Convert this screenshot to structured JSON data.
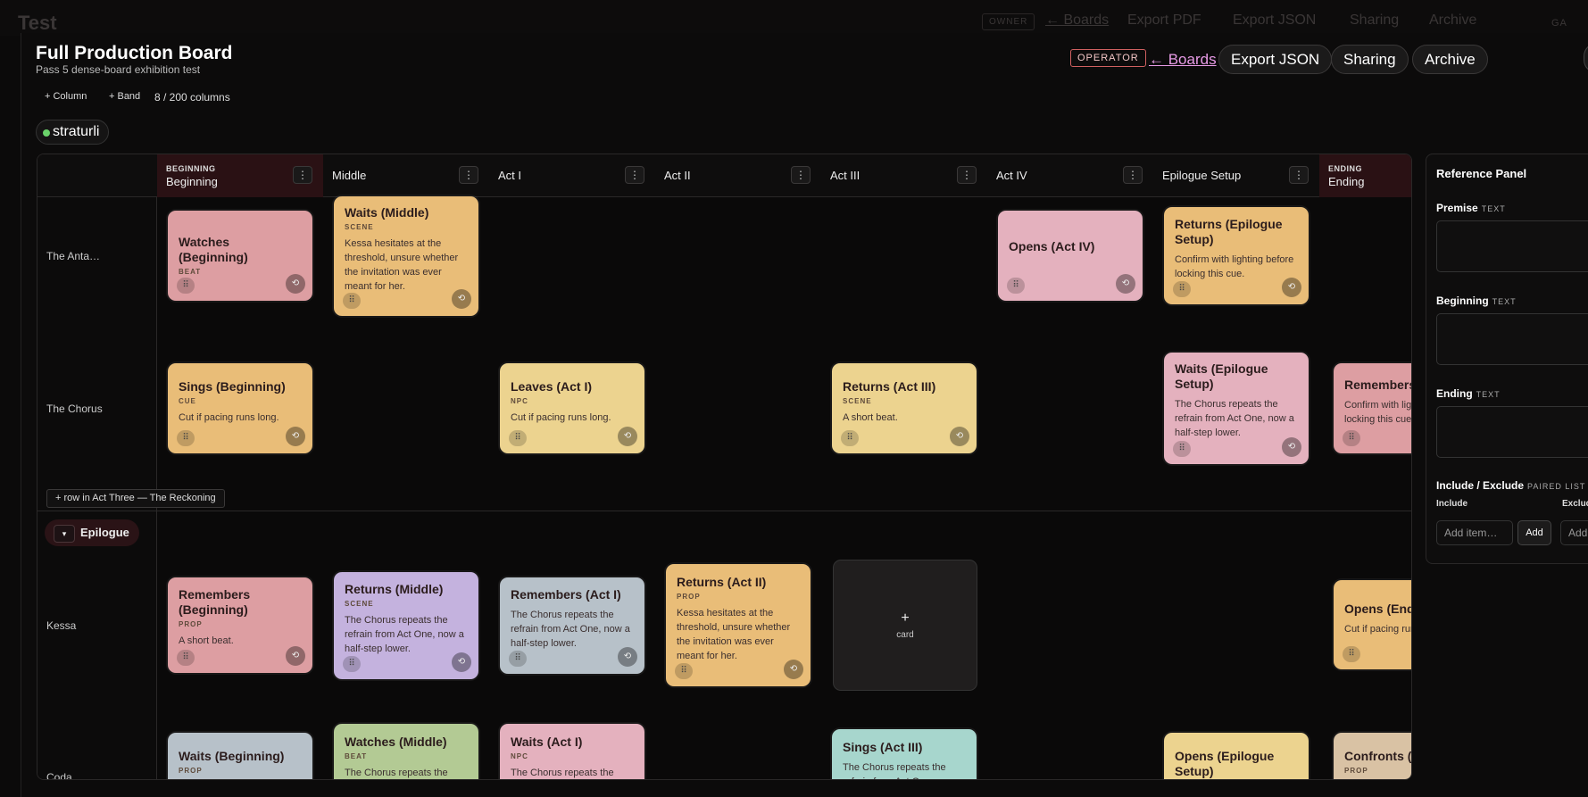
{
  "background_app": {
    "title": "Test",
    "owner_badge": "OWNER",
    "boards_link": "← Boards",
    "export_pdf": "Export PDF",
    "export_json": "Export JSON",
    "sharing": "Sharing",
    "archive": "Archive",
    "avatar": "GA"
  },
  "header": {
    "title": "Full Production Board",
    "subtitle": "Pass 5 dense-board exhibition test",
    "role_badge": "OPERATOR",
    "boards_link": "← Boards",
    "export_json": "Export JSON",
    "sharing": "Sharing",
    "archive": "Archive"
  },
  "toolbar": {
    "add_column": "+ Column",
    "add_band": "+ Band",
    "column_count": "8 / 200 columns"
  },
  "presence": {
    "user": "straturli",
    "status_color": "#6ad26a"
  },
  "columns": [
    {
      "kicker": "BEGINNING",
      "name": "Beginning",
      "menu": "⋮"
    },
    {
      "name": "Middle",
      "menu": "⋮"
    },
    {
      "name": "Act I",
      "menu": "⋮"
    },
    {
      "name": "Act II",
      "menu": "⋮"
    },
    {
      "name": "Act III",
      "menu": "⋮"
    },
    {
      "name": "Act IV",
      "menu": "⋮"
    },
    {
      "name": "Epilogue Setup",
      "menu": "⋮"
    },
    {
      "kicker": "ENDING",
      "name": "Ending"
    }
  ],
  "rows": [
    "The Anta…",
    "The Chorus",
    "Kessa",
    "Coda"
  ],
  "add_row_label": "+ row in Act Three — The Reckoning",
  "band": {
    "toggle": "▾",
    "name": "Epilogue"
  },
  "card_controls": {
    "drag": "⠿",
    "cycle": "⟲"
  },
  "cards": {
    "c1": {
      "title": "Watches (Beginning)",
      "type": "BEAT"
    },
    "c2": {
      "title": "Waits (Middle)",
      "type": "SCENE",
      "body": "Kessa hesitates at the threshold, unsure whether the invitation was ever meant for her."
    },
    "c3": {
      "title": "Opens (Act IV)"
    },
    "c4": {
      "title": "Returns (Epilogue Setup)",
      "body": "Confirm with lighting before locking this cue."
    },
    "c5": {
      "title": "Sings (Beginning)",
      "type": "CUE",
      "body": "Cut if pacing runs long."
    },
    "c6": {
      "title": "Leaves (Act I)",
      "type": "NPC",
      "body": "Cut if pacing runs long."
    },
    "c7": {
      "title": "Returns (Act III)",
      "type": "SCENE",
      "body": "A short beat."
    },
    "c8": {
      "title": "Waits (Epilogue Setup)",
      "body": "The Chorus repeats the refrain from Act One, now a half-step lower."
    },
    "c9": {
      "title": "Remembers (Ending)",
      "body": "Confirm with lighting before locking this cue."
    },
    "c10": {
      "title": "Remembers (Beginning)",
      "type": "PROP",
      "body": "A short beat."
    },
    "c11": {
      "title": "Returns (Middle)",
      "type": "SCENE",
      "body": "The Chorus repeats the refrain from Act One, now a half-step lower."
    },
    "c12": {
      "title": "Remembers (Act I)",
      "body": "The Chorus repeats the refrain from Act One, now a half-step lower."
    },
    "c13": {
      "title": "Returns (Act II)",
      "type": "PROP",
      "body": "Kessa hesitates at the threshold, unsure whether the invitation was ever meant for her."
    },
    "c14": {
      "title": "Opens (Ending)",
      "body": "Cut if pacing runs long."
    },
    "c15": {
      "title": "Waits (Beginning)",
      "type": "PROP"
    },
    "c16": {
      "title": "Watches (Middle)",
      "type": "BEAT",
      "body": "The Chorus repeats the"
    },
    "c17": {
      "title": "Waits (Act I)",
      "type": "NPC",
      "body": "The Chorus repeats the"
    },
    "c18": {
      "title": "Sings (Act III)",
      "body": "The Chorus repeats the refrain from Act One, now"
    },
    "c19": {
      "title": "Opens (Epilogue Setup)"
    },
    "c20": {
      "title": "Confronts (Ending)",
      "type": "PROP"
    }
  },
  "add_card": {
    "plus": "+",
    "label": "card"
  },
  "panel": {
    "title": "Reference Panel",
    "fields": [
      {
        "label": "Premise",
        "kind": "TEXT"
      },
      {
        "label": "Beginning",
        "kind": "TEXT"
      },
      {
        "label": "Ending",
        "kind": "TEXT"
      }
    ],
    "paired": {
      "label": "Include / Exclude",
      "kind": "PAIRED LIST",
      "include": "Include",
      "exclude": "Exclude",
      "placeholder": "Add item…",
      "placeholder_short": "Add",
      "add_button": "Add"
    }
  }
}
